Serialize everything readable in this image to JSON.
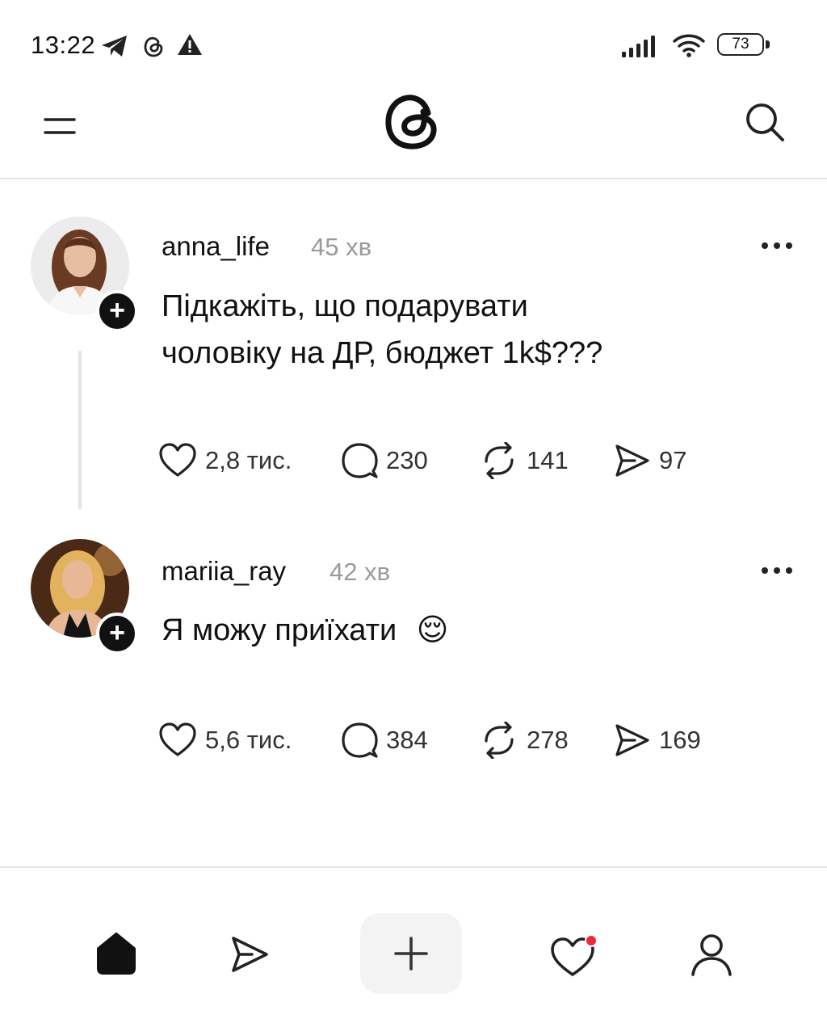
{
  "status_bar": {
    "time": "13:22",
    "icons": [
      "telegram-icon",
      "threads-small-icon",
      "warning-icon",
      "signal-icon",
      "wifi-icon"
    ],
    "battery": "73"
  },
  "header": {
    "logo": "threads-logo",
    "icons": [
      "menu-icon",
      "search-icon"
    ]
  },
  "posts": [
    {
      "username": "anna_life",
      "time": "45 хв",
      "text_line1": "Підкажіть, що подарувати",
      "text_line2": "чоловіку на ДР, бюджет 1k$???",
      "likes": "2,8 тис.",
      "comments": "230",
      "reposts": "141",
      "shares": "97"
    },
    {
      "username": "mariia_ray",
      "time": "42 хв",
      "text": "Я можу приїхати",
      "emoji": "😌",
      "likes": "5,6 тис.",
      "comments": "384",
      "reposts": "278",
      "shares": "169"
    }
  ],
  "bottom_nav": {
    "items": [
      "home-icon",
      "send-icon",
      "plus-icon",
      "heart-icon",
      "profile-icon"
    ]
  },
  "colors": {
    "text": "#111111",
    "muted": "#9a9a9a",
    "notification": "#f0283c"
  }
}
